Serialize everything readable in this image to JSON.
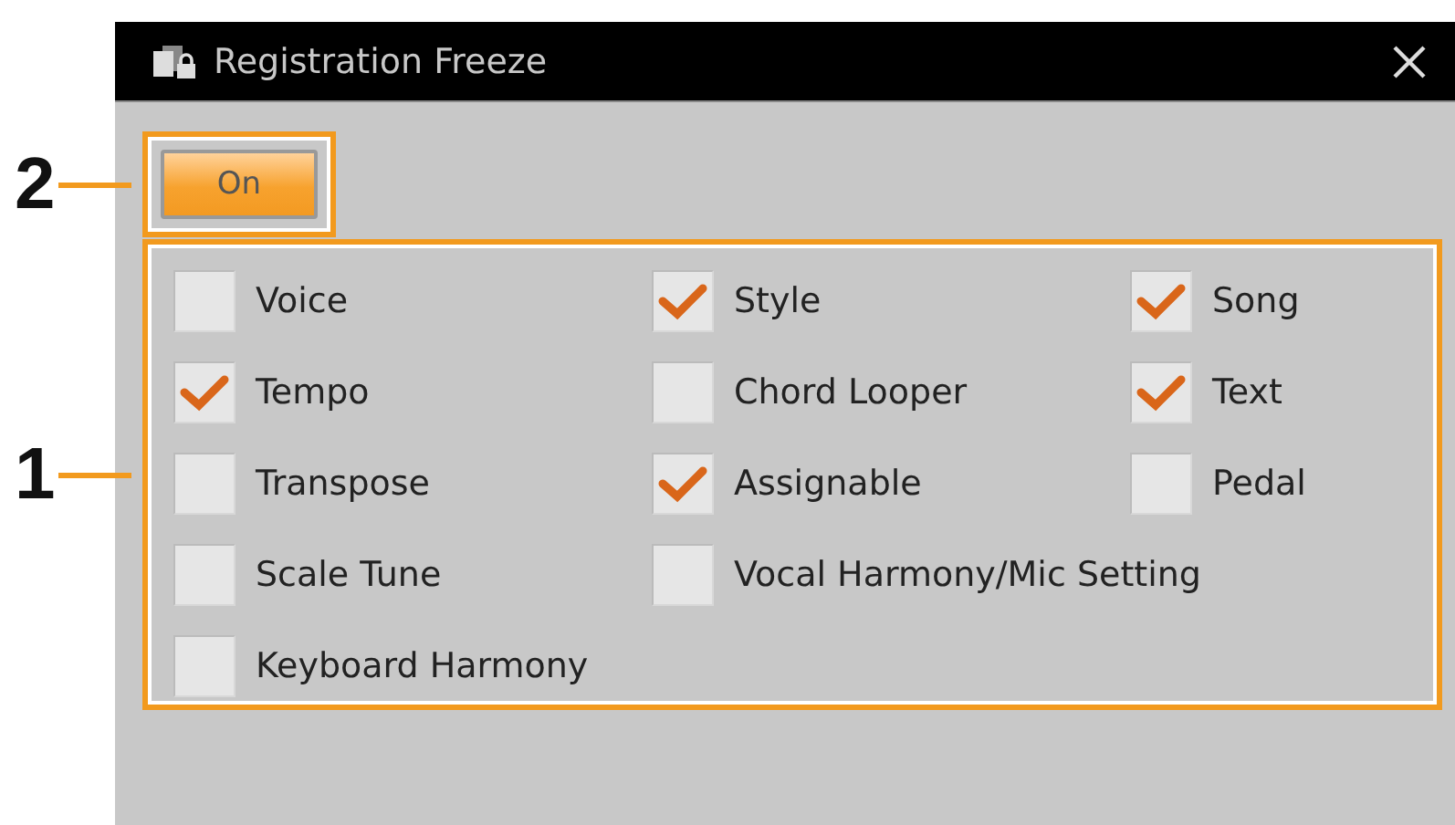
{
  "dialog": {
    "title": "Registration Freeze",
    "toggle": {
      "label": "On",
      "on": true
    },
    "rows": [
      [
        {
          "label": "Voice",
          "checked": false
        },
        {
          "label": "Style",
          "checked": true
        },
        {
          "label": "Song",
          "checked": true
        }
      ],
      [
        {
          "label": "Tempo",
          "checked": true
        },
        {
          "label": "Chord Looper",
          "checked": false
        },
        {
          "label": "Text",
          "checked": true
        }
      ],
      [
        {
          "label": "Transpose",
          "checked": false
        },
        {
          "label": "Assignable",
          "checked": true
        },
        {
          "label": "Pedal",
          "checked": false
        }
      ],
      [
        {
          "label": "Scale Tune",
          "checked": false
        },
        {
          "label": "Vocal Harmony/Mic Setting",
          "checked": false
        }
      ],
      [
        {
          "label": "Keyboard Harmony",
          "checked": false
        }
      ]
    ]
  },
  "callouts": [
    {
      "label": "2"
    },
    {
      "label": "1"
    }
  ]
}
